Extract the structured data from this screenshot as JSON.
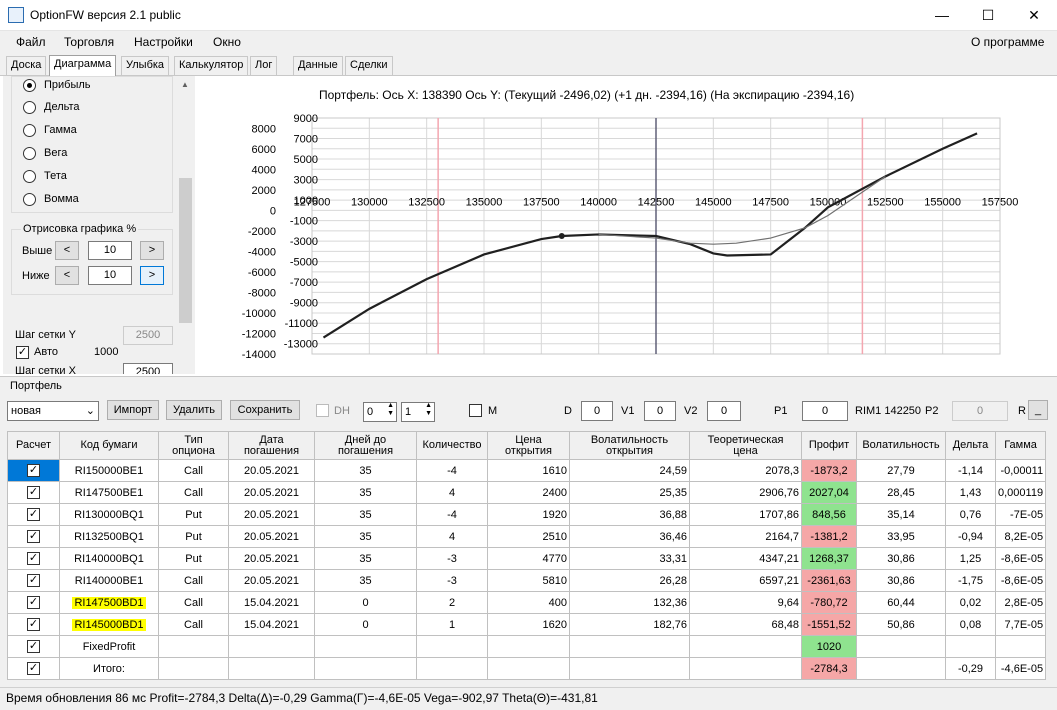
{
  "window": {
    "title": "OptionFW версия 2.1 public",
    "minimize": "—",
    "maximize": "☐",
    "close": "✕"
  },
  "menu": {
    "file": "Файл",
    "trade": "Торговля",
    "settings": "Настройки",
    "window": "Окно",
    "about": "О программе"
  },
  "tabs": [
    "Доска",
    "Диаграмма",
    "Улыбка",
    "Калькулятор",
    "Лог",
    "Данные",
    "Сделки"
  ],
  "left": {
    "radios": [
      "Прибыль",
      "Дельта",
      "Гамма",
      "Вега",
      "Тета",
      "Вомма"
    ],
    "draw_group": "Отрисовка графика %",
    "above_label": "Выше",
    "above_value": "10",
    "below_label": "Ниже",
    "below_value": "10",
    "grid_y_label": "Шаг сетки Y",
    "grid_y_value": "2500",
    "auto_label": "Авто",
    "auto_value": "1000",
    "grid_x_label": "Шаг сетки X",
    "grid_x_value": "2500"
  },
  "chart_title": "Портфель:  Ось X:  138390  Ось Y:   (Текущий -2496,02)   (+1 дн. -2394,16)   (На экспирацию -2394,16)",
  "chart_data": {
    "type": "line",
    "xlim": [
      127500,
      157500
    ],
    "ylim": [
      -14000,
      9000
    ],
    "x_ticks": [
      127500,
      130000,
      132500,
      135000,
      137500,
      140000,
      142500,
      145000,
      147500,
      150000,
      152500,
      155000,
      157500
    ],
    "y_ticks_left": [
      8000,
      6000,
      4000,
      2000,
      0,
      -2000,
      -4000,
      -6000,
      -8000,
      -10000,
      -12000,
      -14000
    ],
    "y_ticks_right": [
      9000,
      7000,
      5000,
      3000,
      1000,
      -1000,
      -3000,
      -5000,
      -7000,
      -9000,
      -11000,
      -13000
    ],
    "series": [
      {
        "x": [
          128000,
          130000,
          132500,
          135000,
          137500,
          138390,
          140000,
          142500,
          144000,
          145000,
          145600,
          147500,
          149000,
          150000,
          152500,
          155000,
          156500
        ],
        "y": [
          -12400,
          -9600,
          -6700,
          -4300,
          -2800,
          -2500,
          -2350,
          -2500,
          -3300,
          -4200,
          -4400,
          -4300,
          -1700,
          300,
          3300,
          6000,
          7500
        ]
      },
      {
        "x": [
          140000,
          142500,
          144000,
          145000,
          146000,
          147500,
          149000,
          150000,
          152500
        ],
        "y": [
          -2350,
          -2700,
          -3200,
          -3300,
          -3200,
          -2700,
          -1700,
          -500,
          3300
        ]
      }
    ],
    "marker": {
      "x": 138390,
      "y": -2496
    },
    "vlines_red": [
      133000,
      151500
    ],
    "vline_dark": 142500,
    "colors": {
      "curve": "#202020",
      "curve_thin": "#707070",
      "red": "#f4a6b0",
      "dark": "#606078",
      "grid": "#d8d8d8"
    }
  },
  "portfolio": {
    "label": "Портфель",
    "select_value": "новая",
    "import": "Импорт",
    "delete": "Удалить",
    "save": "Сохранить",
    "dh": "DH",
    "spin1": "0",
    "spin2": "1",
    "m": "M",
    "d_label": "D",
    "d_value": "0",
    "v1_label": "V1",
    "v1_value": "0",
    "v2_label": "V2",
    "v2_value": "0",
    "p1_label": "P1",
    "p1_value": "0",
    "rim": "RIM1 142250",
    "p2_label": "P2",
    "p2_value": "0",
    "r_label": "R"
  },
  "table": {
    "headers": [
      "Расчет",
      "Код бумаги",
      "Тип\nопциона",
      "Дата\nпогашения",
      "Дней до\nпогашения",
      "Количество",
      "Цена\nоткрытия",
      "Волатильность\nоткрытия",
      "Теоретическая\nцена",
      "Профит",
      "Волатильность",
      "Дельта",
      "Гамма"
    ],
    "rows": [
      {
        "code": "RI150000BE1",
        "type": "Call",
        "date": "20.05.2021",
        "days": "35",
        "qty": "-4",
        "price": "1610",
        "vol_open": "24,59",
        "theo": "2078,3",
        "profit": "-1873,2",
        "profit_sign": "neg",
        "vol": "27,79",
        "delta": "-1,14",
        "gamma": "-0,00011"
      },
      {
        "code": "RI147500BE1",
        "type": "Call",
        "date": "20.05.2021",
        "days": "35",
        "qty": "4",
        "price": "2400",
        "vol_open": "25,35",
        "theo": "2906,76",
        "profit": "2027,04",
        "profit_sign": "pos",
        "vol": "28,45",
        "delta": "1,43",
        "gamma": "0,000119"
      },
      {
        "code": "RI130000BQ1",
        "type": "Put",
        "date": "20.05.2021",
        "days": "35",
        "qty": "-4",
        "price": "1920",
        "vol_open": "36,88",
        "theo": "1707,86",
        "profit": "848,56",
        "profit_sign": "pos",
        "vol": "35,14",
        "delta": "0,76",
        "gamma": "-7E-05"
      },
      {
        "code": "RI132500BQ1",
        "type": "Put",
        "date": "20.05.2021",
        "days": "35",
        "qty": "4",
        "price": "2510",
        "vol_open": "36,46",
        "theo": "2164,7",
        "profit": "-1381,2",
        "profit_sign": "neg",
        "vol": "33,95",
        "delta": "-0,94",
        "gamma": "8,2E-05"
      },
      {
        "code": "RI140000BQ1",
        "type": "Put",
        "date": "20.05.2021",
        "days": "35",
        "qty": "-3",
        "price": "4770",
        "vol_open": "33,31",
        "theo": "4347,21",
        "profit": "1268,37",
        "profit_sign": "pos",
        "vol": "30,86",
        "delta": "1,25",
        "gamma": "-8,6E-05"
      },
      {
        "code": "RI140000BE1",
        "type": "Call",
        "date": "20.05.2021",
        "days": "35",
        "qty": "-3",
        "price": "5810",
        "vol_open": "26,28",
        "theo": "6597,21",
        "profit": "-2361,63",
        "profit_sign": "neg",
        "vol": "30,86",
        "delta": "-1,75",
        "gamma": "-8,6E-05"
      },
      {
        "code": "RI147500BD1",
        "type": "Call",
        "date": "15.04.2021",
        "days": "0",
        "qty": "2",
        "price": "400",
        "vol_open": "132,36",
        "theo": "9,64",
        "profit": "-780,72",
        "profit_sign": "neg",
        "vol": "60,44",
        "delta": "0,02",
        "gamma": "2,8E-05"
      },
      {
        "code": "RI145000BD1",
        "type": "Call",
        "date": "15.04.2021",
        "days": "0",
        "qty": "1",
        "price": "1620",
        "vol_open": "182,76",
        "theo": "68,48",
        "profit": "-1551,52",
        "profit_sign": "neg",
        "vol": "50,86",
        "delta": "0,08",
        "gamma": "7,7E-05"
      }
    ],
    "fixed_label": "FixedProfit",
    "fixed_value": "1020",
    "total_label": "Итого:",
    "total_profit": "-2784,3",
    "total_delta": "-0,29",
    "total_gamma": "-4,6E-05"
  },
  "status": "Время обновления 86 мс   Profit=-2784,3 Delta(Δ)=-0,29 Gamma(Γ)=-4,6E-05 Vega=-902,97 Theta(Θ)=-431,81"
}
